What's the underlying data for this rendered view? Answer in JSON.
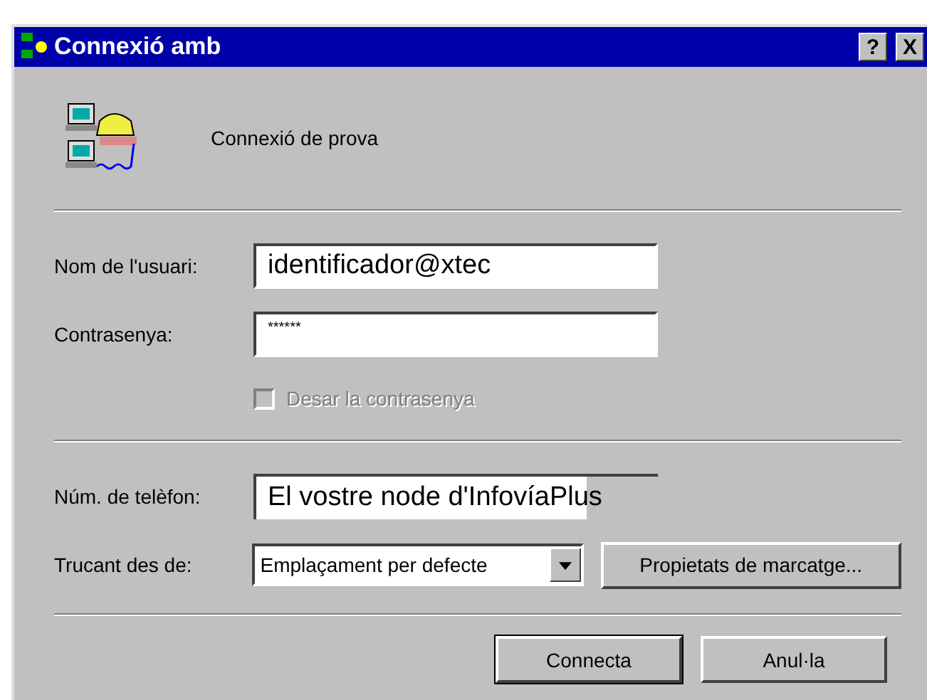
{
  "window": {
    "title": "Connexió amb",
    "buttons": [
      "?",
      "X"
    ]
  },
  "connection_name": "Connexió de prova",
  "username": {
    "label": "Nom de l'usuari:",
    "value": "identificador@xtec"
  },
  "password": {
    "label": "Contrasenya:",
    "value": "******"
  },
  "save_password": {
    "label": "Desar la contrasenya",
    "checked": false,
    "disabled": true
  },
  "phone": {
    "label": "Núm. de telèfon:",
    "value": "El vostre node d'InfovíaPlus"
  },
  "dial_from": {
    "label": "Trucant des de:",
    "value": "Emplaçament per defecte"
  },
  "dialing_properties_button": "Propietats de marcatge...",
  "buttons": [
    {
      "label": "Connecta",
      "default": true
    },
    {
      "label": "Anul·la",
      "default": false
    }
  ]
}
